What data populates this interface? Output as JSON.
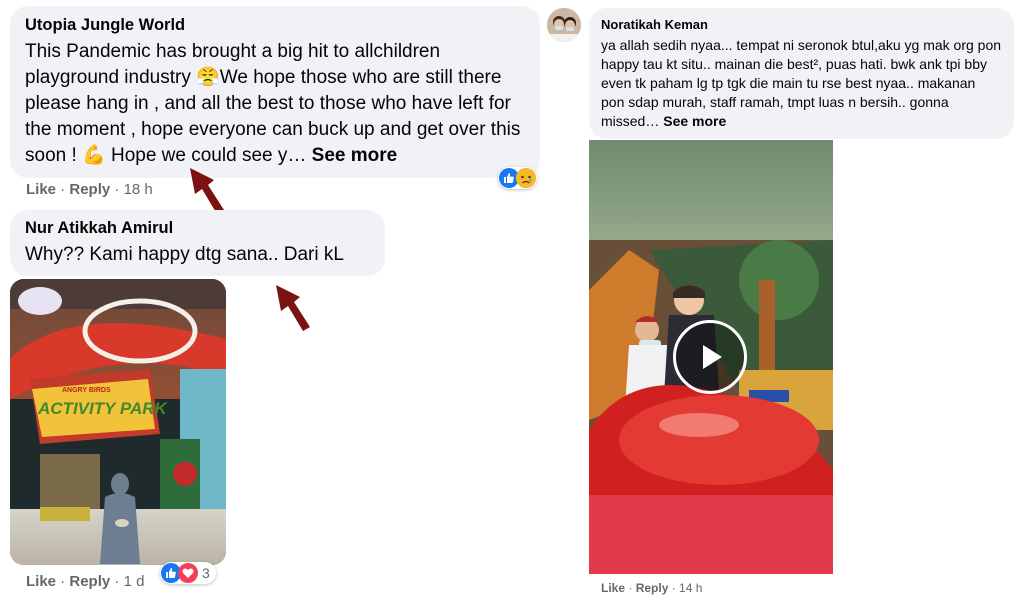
{
  "comment1": {
    "author": "Utopia Jungle World",
    "text": "This Pandemic has brought a big hit to allchildren playground industry 😤We hope those who are still there please hang in , and all the best to those who have left for the moment , hope everyone can buck up and get over this soon ! 💪 Hope we could see y…",
    "see_more": "See more",
    "like": "Like",
    "reply": "Reply",
    "time": "18 h",
    "reactions": [
      "like",
      "sad"
    ]
  },
  "comment2": {
    "author": "Nur Atikkah Amirul",
    "text": "Why?? Kami happy dtg sana.. Dari kL",
    "photo_sign": "ACTIVITY PARK",
    "photo_brand": "ANGRY BIRDS",
    "like": "Like",
    "reply": "Reply",
    "time": "1 d",
    "reaction_count": "3",
    "reactions": [
      "like",
      "love"
    ]
  },
  "comment3": {
    "author": "Noratikah Keman",
    "text": "ya allah sedih nyaa... tempat ni seronok btul,aku yg mak org pon happy tau kt situ.. mainan die best², puas hati. bwk ank tpi bby even tk paham lg tp tgk die main tu rse best nyaa.. makanan pon sdap murah, staff ramah, tmpt luas n bersih.. gonna missed…",
    "see_more": "See more",
    "like": "Like",
    "reply": "Reply",
    "time": "14 h"
  },
  "colors": {
    "bubble": "#f0f2f5",
    "meta_text": "#65676b",
    "like_blue": "#1877f2",
    "love_red": "#f33e58",
    "arrow": "#7a1212"
  },
  "icons": [
    "like-reaction-icon",
    "sad-reaction-icon",
    "love-reaction-icon",
    "play-icon",
    "annotation-arrow-icon"
  ]
}
